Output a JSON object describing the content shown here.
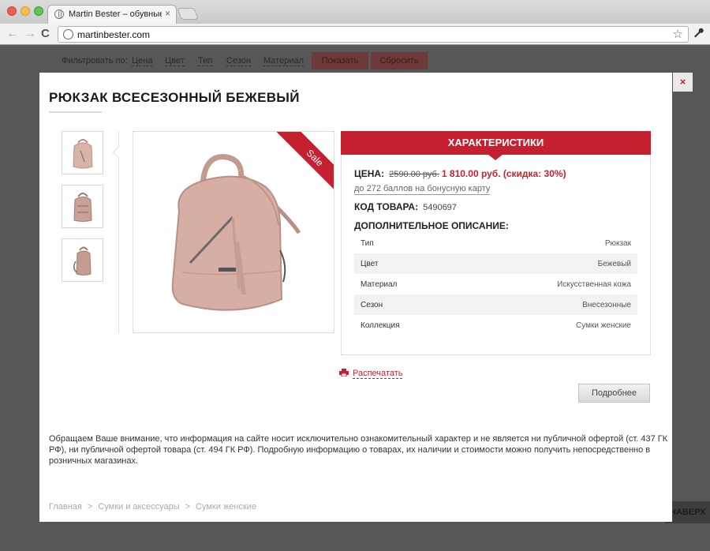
{
  "browser": {
    "tab_title": "Martin Bester – обувные сал",
    "tab_close": "×",
    "url": "martinbester.com",
    "back": "←",
    "forward": "→",
    "reload": "C",
    "star": "☆",
    "wrench": "🔧"
  },
  "filters": {
    "label": "Фильтровать по:",
    "items": [
      "Цена",
      "Цвет",
      "Тип",
      "Сезон",
      "Материал"
    ],
    "show_button": "Показать",
    "reset_button": "Сбросить"
  },
  "scroll_top": "НАВЕРХ",
  "modal": {
    "close": "×",
    "title": "РЮКЗАК ВСЕСЕЗОННЫЙ БЕЖЕВЫЙ",
    "sale_badge": "Sale",
    "spec": {
      "header": "ХАРАКТЕРИСТИКИ",
      "price_label": "ЦЕНА:",
      "old_price": "2590.00 руб.",
      "new_price": "1 810.00 руб. (скидка: 30%)",
      "bonus": "до 272 баллов на бонусную карту",
      "code_label": "КОД ТОВАРА:",
      "code_value": "5490697",
      "desc_title": "ДОПОЛНИТЕЛЬНОЕ ОПИСАНИЕ:",
      "attributes": [
        {
          "name": "Тип",
          "value": "Рюкзак"
        },
        {
          "name": "Цвет",
          "value": "Бежевый"
        },
        {
          "name": "Материал",
          "value": "Искусственная кожа"
        },
        {
          "name": "Сезон",
          "value": "Внесезонные"
        },
        {
          "name": "Коллекция",
          "value": "Сумки женские"
        }
      ]
    },
    "print_link": "Распечатать",
    "more_button": "Подробнее",
    "notice": "Обращаем Ваше внимание, что информация на сайте носит исключительно ознакомительный характер и не является ни публичной офертой (ст. 437 ГК РФ), ни публичной офертой товара (ст. 494 ГК РФ). Подробную информацию о товарах, их наличии и стоимости можно получить непосредственно в розничных магазинах.",
    "breadcrumbs": [
      "Главная",
      "Сумки и аксессуары",
      "Сумки женские"
    ],
    "breadcrumb_sep": ">"
  },
  "colors": {
    "accent": "#c4202f",
    "bag": "#d4a99e"
  }
}
